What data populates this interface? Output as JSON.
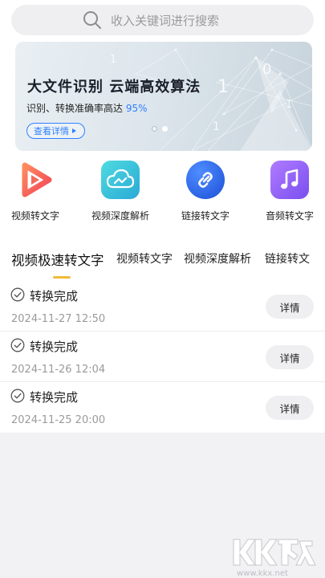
{
  "search": {
    "placeholder": "收入关键词进行搜索"
  },
  "banner": {
    "title": "大文件识别 云端高效算法",
    "subtitle": "识别、转换准确率高达",
    "percent": "95%",
    "button": "查看详情",
    "deco_numbers": [
      "1",
      "0",
      "1",
      "1",
      "1"
    ],
    "pages": 2,
    "active_page": 2
  },
  "features": [
    {
      "label": "视频转文字",
      "icon": "video-play-icon",
      "color": "#f26b5b"
    },
    {
      "label": "视频深度解析",
      "icon": "cloud-icon",
      "color": "#35c6d8"
    },
    {
      "label": "链接转文字",
      "icon": "link-icon",
      "color": "#2f6bf0"
    },
    {
      "label": "音频转文字",
      "icon": "music-note-icon",
      "color": "#8a62f2"
    }
  ],
  "tabs": [
    {
      "label": "视频极速转文字",
      "active": true
    },
    {
      "label": "视频转文字",
      "active": false
    },
    {
      "label": "视频深度解析",
      "active": false
    },
    {
      "label": "链接转文",
      "active": false
    }
  ],
  "records": [
    {
      "status": "转换完成",
      "time": "2024-11-27 12:50",
      "action": "详情"
    },
    {
      "status": "转换完成",
      "time": "2024-11-26 12:04",
      "action": "详情"
    },
    {
      "status": "转换完成",
      "time": "2024-11-25 20:00",
      "action": "详情"
    }
  ],
  "watermark": {
    "logo": "KK下载",
    "url": "www.kkx.net"
  },
  "colors": {
    "accent": "#2f80ff",
    "tab_indicator": "#f2b93b"
  }
}
